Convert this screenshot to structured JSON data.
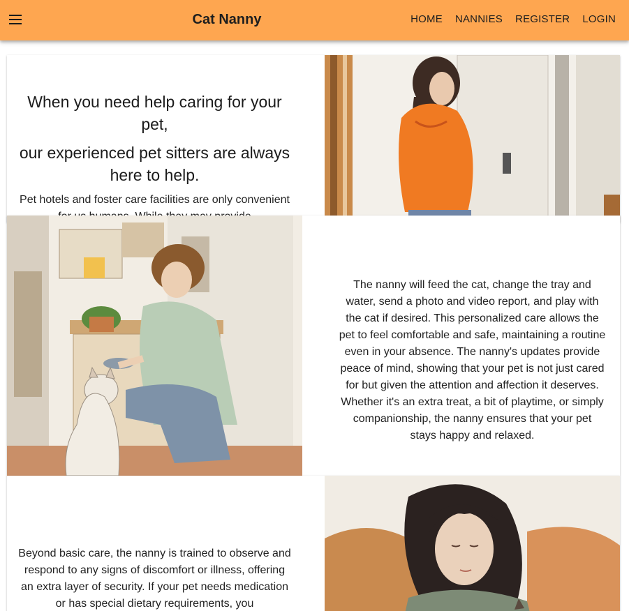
{
  "header": {
    "brand": "Cat Nanny",
    "nav": [
      "HOME",
      "NANNIES",
      "REGISTER",
      "LOGIN"
    ],
    "color": "#fea650"
  },
  "sections": [
    {
      "heading_line1": "When you need help caring for your pet,",
      "heading_line2": "our experienced pet sitters are always here to help.",
      "text": "Pet hotels and foster care facilities are only convenient for us humans. While they may provide",
      "image": "woman-orange-hoodie-illustration"
    },
    {
      "text": "The nanny will feed the cat, change the tray and water, send a photo and video report, and play with the cat if desired. This personalized care allows the pet to feel comfortable and safe, maintaining a routine even in your absence. The nanny's updates provide peace of mind, showing that your pet is not just cared for but given the attention and affection it deserves. Whether it's an extra treat, a bit of playtime, or simply companionship, the nanny ensures that your pet stays happy and relaxed.",
      "image": "man-feeding-cat-illustration"
    },
    {
      "text": "Beyond basic care, the nanny is trained to observe and respond to any signs of discomfort or illness, offering an extra layer of security. If your pet needs medication or has special dietary requirements, you",
      "image": "woman-with-cat-illustration"
    }
  ]
}
